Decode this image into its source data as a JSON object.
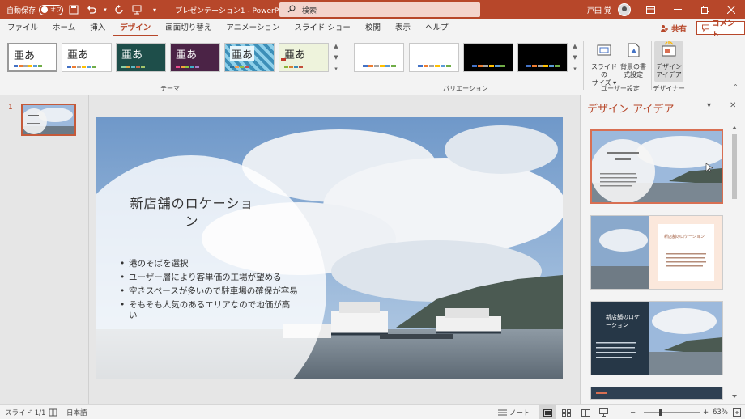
{
  "titlebar": {
    "autosave_label": "自動保存",
    "autosave_state": "オフ",
    "doc_title": "プレゼンテーション1 - PowerPoint",
    "search_placeholder": "検索",
    "user_name": "戸田 覚"
  },
  "menu": {
    "items": [
      "ファイル",
      "ホーム",
      "挿入",
      "デザイン",
      "画面切り替え",
      "アニメーション",
      "スライド ショー",
      "校閲",
      "表示",
      "ヘルプ"
    ],
    "active": "デザイン",
    "share_label": "共有",
    "comment_label": "コメント"
  },
  "ribbon": {
    "theme_glyph": "亜あ",
    "group_theme": "テーマ",
    "group_variation": "バリエーション",
    "group_user": "ユーザー設定",
    "group_designer": "デザイナー",
    "btn_slide_size": [
      "スライドの",
      "サイズ ▾"
    ],
    "btn_bg_format": [
      "背景の書",
      "式設定"
    ],
    "btn_design_ideas": [
      "デザイン",
      "アイデア"
    ]
  },
  "thumbnails": {
    "slide_number": "1"
  },
  "slide": {
    "title": "新店舗のロケーション",
    "bullets": [
      "港のそばを選択",
      "ユーザー層により客単価の工場が望める",
      "空きスペースが多いので駐車場の確保が容易",
      "そもそも人気のあるエリアなので地価が高い"
    ]
  },
  "design_pane": {
    "title": "デザイン アイデア",
    "idea2_title": "新店舗のロケーション",
    "idea3_title": "新店舗のロケーション"
  },
  "status": {
    "slide_info": "スライド 1/1",
    "language": "日本語",
    "notes_label": "ノート",
    "zoom": "63%"
  },
  "colors": {
    "accent": "#b7472a",
    "ribbon_bg": "#f3f3f3"
  }
}
